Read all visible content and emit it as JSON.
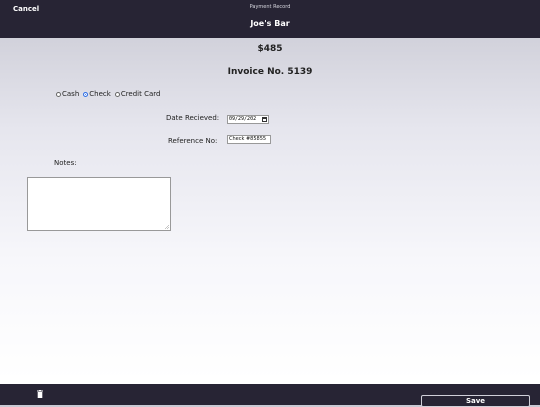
{
  "header": {
    "cancel_label": "Cancel",
    "subtitle": "Payment Record",
    "title": "Joe's Bar"
  },
  "summary": {
    "amount": "$485",
    "invoice": "Invoice No. 5139"
  },
  "payment_method": {
    "options": [
      "Cash",
      "Check",
      "Credit Card"
    ],
    "selected": "Check"
  },
  "form": {
    "date_label": "Date Recieved:",
    "date_value": "09/29/202",
    "reference_label": "Reference No:",
    "reference_value": "Check #85855",
    "notes_label": "Notes:",
    "notes_value": ""
  },
  "footer": {
    "save_label": "Save",
    "delete_icon": "trash-icon"
  },
  "colors": {
    "bar_bg": "#272434",
    "radio_selected": "#2f6fe6"
  }
}
